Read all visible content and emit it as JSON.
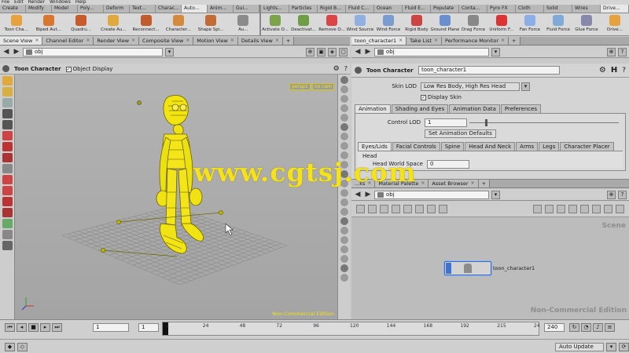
{
  "menubar": [
    "File",
    "Edit",
    "Render",
    "Windows",
    "Help"
  ],
  "shelf_tabs_left": [
    "Create",
    "Modify",
    "Model",
    "Poly...",
    "Deform",
    "Text...",
    "Charac...",
    "Auto...",
    "Anim...",
    "Gui..."
  ],
  "shelf_tabs_right": [
    "Lights...",
    "Particles",
    "Rigid B...",
    "Fluid C...",
    "Ocean",
    "Fluid E...",
    "Populate",
    "Conta...",
    "Pyro FX",
    "Cloth",
    "Solid",
    "Wires",
    "Drive..."
  ],
  "shelf_tools_left": [
    "Toon Cha...",
    "Biped Aut...",
    "Quadru...",
    "Create Au...",
    "Reconnect...",
    "Character...",
    "Shape Spi...",
    "Au..."
  ],
  "shelf_tools_right": [
    "Activate O...",
    "Deactivat...",
    "Remove O...",
    "Wind Source",
    "Wind Force",
    "Rigid Body",
    "Ground Plane",
    "Drag Force",
    "Uniform F...",
    "Fan Force",
    "Fluid Force",
    "Glue Force",
    "Drive..."
  ],
  "left_pane_tabs": [
    "Scene View",
    "Channel Editor",
    "Render View",
    "Composite View",
    "Motion View",
    "Details View"
  ],
  "right_pane_tabs": [
    "toon_character1",
    "Take List",
    "Performance Monitor"
  ],
  "left_path": "obj",
  "right_path": "obj",
  "viewport": {
    "node_name": "Toon Character",
    "object_display_label": "Object Display",
    "perspective_label": "persp1",
    "camera_label": "no cam",
    "edition": "Non-Commercial Edition"
  },
  "params": {
    "node_type": "Toon Character",
    "node_name": "toon_character1",
    "skin_lod_label": "Skin LOD",
    "skin_lod_value": "Low Res Body, High Res Head",
    "display_skin_label": "Display Skin",
    "tabs": [
      "Animation",
      "Shading and Eyes",
      "Animation Data",
      "Preferences"
    ],
    "control_lod_label": "Control LOD",
    "control_lod_value": "1",
    "set_defaults_button": "Set Animation Defaults",
    "sub_tabs": [
      "Eyes/Lids",
      "Facial Controls",
      "Spine",
      "Head And Neck",
      "Arms",
      "Legs",
      "Character Placer"
    ],
    "head_label": "Head",
    "head_world_space_label": "Head World Space",
    "head_world_space_value": "0"
  },
  "network_tabs": [
    "...ks",
    "Material Palette",
    "Asset Browser"
  ],
  "network": {
    "scene_label": "Scene",
    "node_label": "toon_character1",
    "edition": "Non-Commercial Edition"
  },
  "timeline": {
    "current_frame": "1",
    "start_frame": "1",
    "ticks": [
      "1",
      "24",
      "48",
      "72",
      "96",
      "120",
      "144",
      "168",
      "192",
      "215",
      "24"
    ],
    "end_frame": "240",
    "auto_update": "Auto Update"
  },
  "watermark": "www.cgtsj.com",
  "colors": {
    "character": "#f2e313",
    "watermark": "#f5e21a",
    "selected_tab": "#e6e6e6"
  }
}
